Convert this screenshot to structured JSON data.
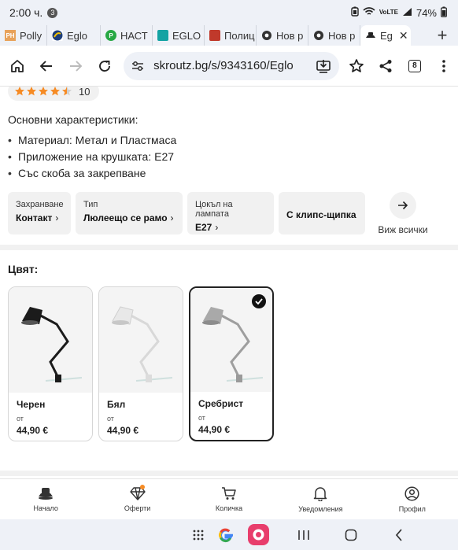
{
  "status_bar": {
    "time": "2:00 ч.",
    "notification_count": "3",
    "network": "VoLTE",
    "battery": "74%"
  },
  "tabs": [
    {
      "label": "Polly",
      "favicon_text": "PH",
      "favicon_color": "#e8a25a"
    },
    {
      "label": "Eglo",
      "favicon_text": "",
      "favicon_color": "#1f3f7a"
    },
    {
      "label": "НАСТ",
      "favicon_text": "P",
      "favicon_color": "#27a844"
    },
    {
      "label": "EGLO",
      "favicon_text": "",
      "favicon_color": "#13a3a3"
    },
    {
      "label": "Полиц",
      "favicon_text": "",
      "favicon_color": "#c0392b"
    },
    {
      "label": "Нов р",
      "favicon_text": "",
      "favicon_color": "#333333"
    },
    {
      "label": "Нов р",
      "favicon_text": "",
      "favicon_color": "#333333"
    },
    {
      "label": "Eg",
      "favicon_text": "",
      "favicon_color": "#222222",
      "active": true
    }
  ],
  "toolbar": {
    "url": "skroutz.bg/s/9343160/Eglo",
    "tab_count": "8"
  },
  "rating": {
    "value": 4.5,
    "max": 5,
    "count": "10",
    "star_color": "#f68b24"
  },
  "characteristics": {
    "title": "Основни характеристики:",
    "items": [
      "Материал: Метал и Пластмаса",
      "Приложение на крушката: E27",
      "Със скоба за закрепване"
    ]
  },
  "specs": [
    {
      "label": "Захранване",
      "value": "Контакт"
    },
    {
      "label": "Тип",
      "value": "Люлеещо се рамо"
    },
    {
      "label": "Цокъл на лампата",
      "value": "E27"
    },
    {
      "label": "",
      "value": "С клипс-щипка"
    }
  ],
  "view_all": "Виж всички",
  "color_section": {
    "title": "Цвят:",
    "variants": [
      {
        "name": "Черен",
        "from": "от",
        "price": "44,90 €",
        "lamp_color": "#1b1b1b",
        "selected": false
      },
      {
        "name": "Бял",
        "from": "от",
        "price": "44,90 €",
        "lamp_color": "#e6e6e6",
        "selected": false
      },
      {
        "name": "Сребрист",
        "from": "от",
        "price": "44,90 €",
        "lamp_color": "#a9a9a9",
        "selected": true
      }
    ]
  },
  "bottom_nav": [
    {
      "label": "Начало",
      "icon": "home-hat-icon"
    },
    {
      "label": "Оферти",
      "icon": "diamond-icon",
      "badge": true
    },
    {
      "label": "Количка",
      "icon": "cart-icon"
    },
    {
      "label": "Уведомления",
      "icon": "bell-icon"
    },
    {
      "label": "Профил",
      "icon": "profile-icon"
    }
  ],
  "colors": {
    "accent": "#f68b24",
    "chrome_bg": "#eef1f7",
    "chip_bg": "#f1f1f1"
  }
}
